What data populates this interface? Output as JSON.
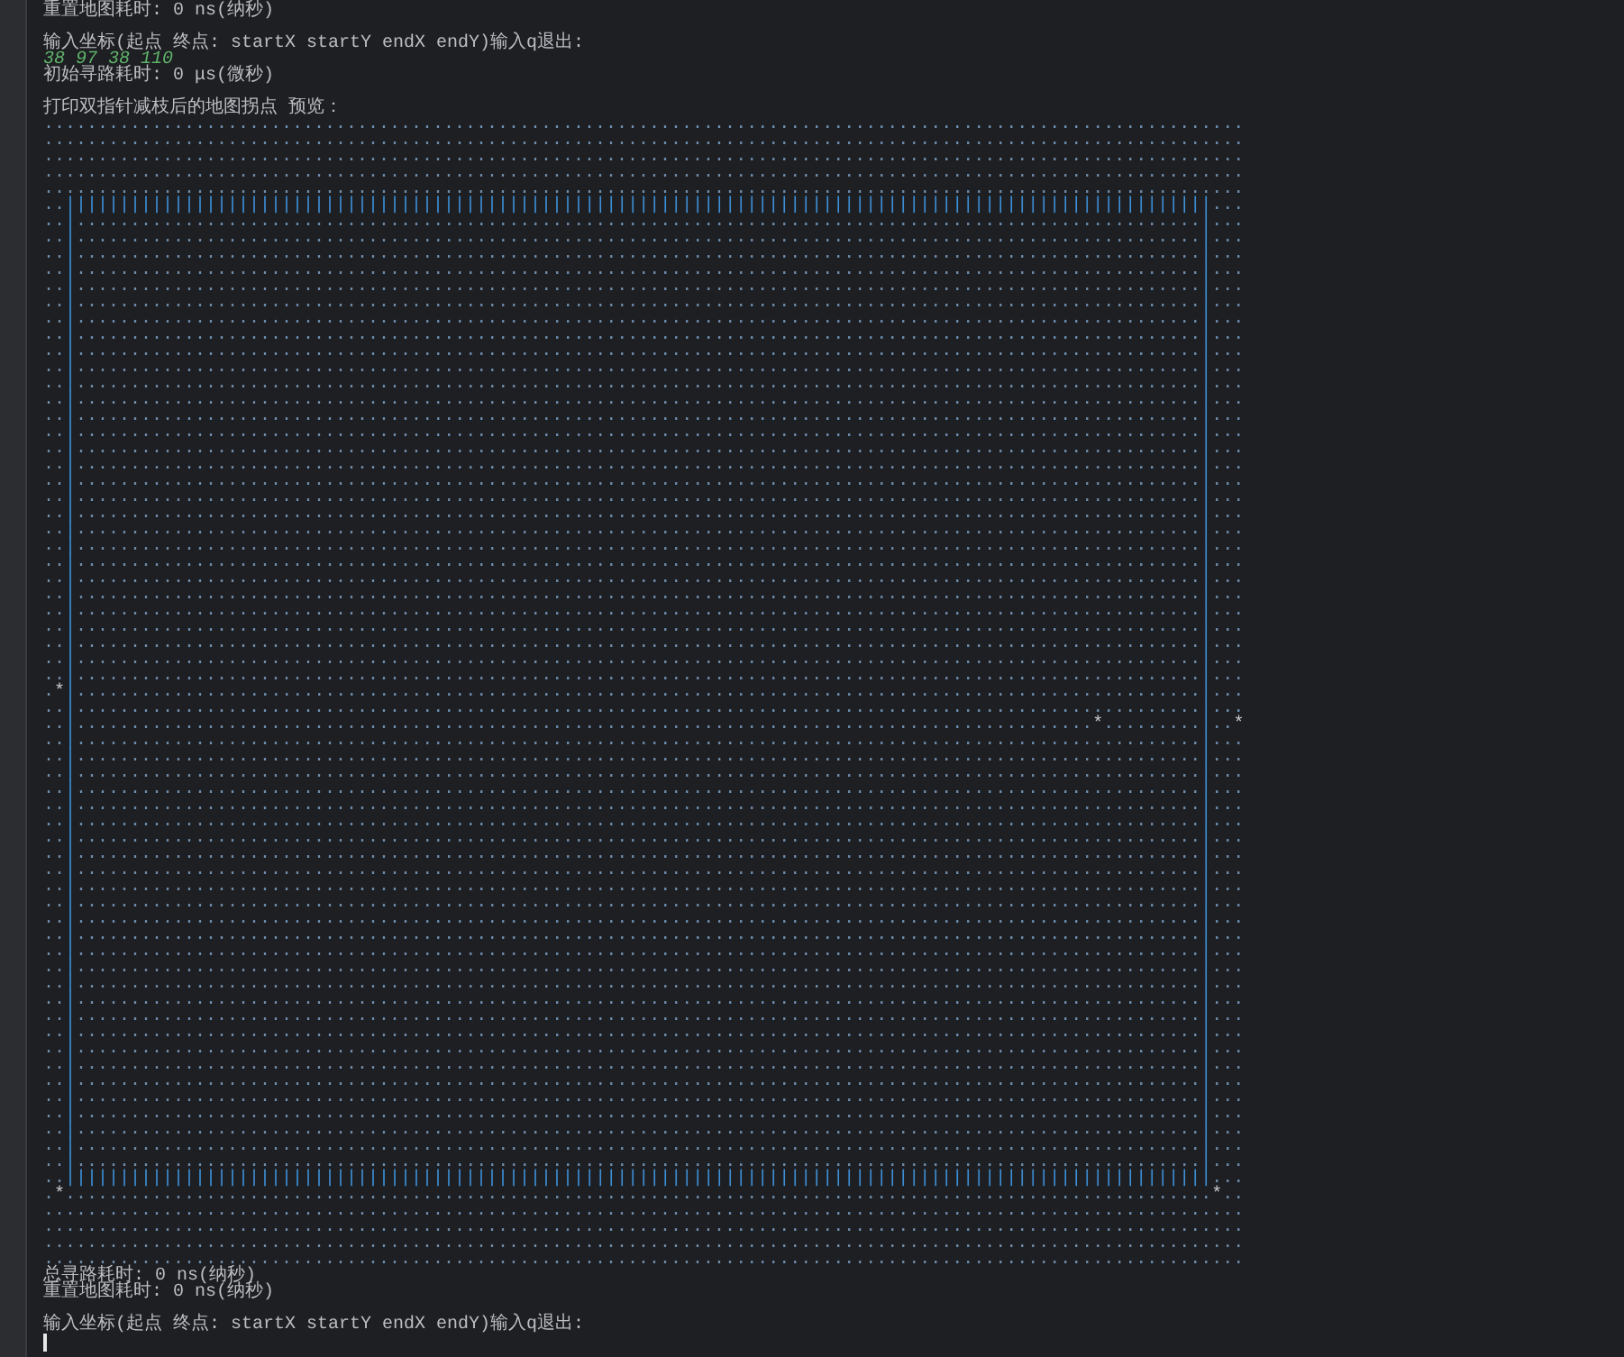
{
  "console": {
    "lines": [
      {
        "kind": "output",
        "text": "重置地图耗时: 0 ns(纳秒)"
      },
      {
        "kind": "blank"
      },
      {
        "kind": "output",
        "text": "输入坐标(起点 终点: startX startY endX endY)输入q退出:"
      },
      {
        "kind": "input",
        "text": "38 97 38 110"
      },
      {
        "kind": "output",
        "text": "初始寻路耗时: 0 μs(微秒)"
      },
      {
        "kind": "blank"
      },
      {
        "kind": "output",
        "text": "打印双指针减枝后的地图拐点 预览："
      },
      {
        "kind": "map",
        "rows": [
          "...............................................................................................................",
          "...............................................................................................................",
          "...............................................................................................................",
          "...............................................................................................................",
          "...............................................................................................................",
          "..||||||||||||||||||||||||||||||||||||||||||||||||||||||||||||||||||||||||||||||||||||||||||||||||||||||||||...",
          "..|........................................................................................................|...",
          "..|........................................................................................................|...",
          "..|........................................................................................................|...",
          "..|........................................................................................................|...",
          "..|........................................................................................................|...",
          "..|........................................................................................................|...",
          "..|........................................................................................................|...",
          "..|........................................................................................................|...",
          "..|........................................................................................................|...",
          "..|........................................................................................................|...",
          "..|........................................................................................................|...",
          "..|........................................................................................................|...",
          "..|........................................................................................................|...",
          "..|........................................................................................................|...",
          "..|........................................................................................................|...",
          "..|........................................................................................................|...",
          "..|........................................................................................................|...",
          "..|........................................................................................................|...",
          "..|........................................................................................................|...",
          "..|........................................................................................................|...",
          "..|........................................................................................................|...",
          "..|........................................................................................................|...",
          "..|........................................................................................................|...",
          "..|........................................................................................................|...",
          "..|........................................................................................................|...",
          "..|........................................................................................................|...",
          "..|........................................................................................................|...",
          "..|........................................................................................................|...",
          "..|........................................................................................................|...",
          ".*|........................................................................................................|...",
          "..|........................................................................................................|...",
          "..|..............................................................................................*.........|..*",
          "..|........................................................................................................|...",
          "..|........................................................................................................|...",
          "..|........................................................................................................|...",
          "..|........................................................................................................|...",
          "..|........................................................................................................|...",
          "..|........................................................................................................|...",
          "..|........................................................................................................|...",
          "..|........................................................................................................|...",
          "..|........................................................................................................|...",
          "..|........................................................................................................|...",
          "..|........................................................................................................|...",
          "..|........................................................................................................|...",
          "..|........................................................................................................|...",
          "..|........................................................................................................|...",
          "..|........................................................................................................|...",
          "..|........................................................................................................|...",
          "..|........................................................................................................|...",
          "..|........................................................................................................|...",
          "..|........................................................................................................|...",
          "..|........................................................................................................|...",
          "..|........................................................................................................|...",
          "..|........................................................................................................|...",
          "..|........................................................................................................|...",
          "..|........................................................................................................|...",
          "..|........................................................................................................|...",
          "..|........................................................................................................|...",
          "..|........................................................................................................|...",
          "..||||||||||||||||||||||||||||||||||||||||||||||||||||||||||||||||||||||||||||||||||||||||||||||||||||||||||...",
          ".*..........................................................................................................*..",
          "...............................................................................................................",
          "...............................................................................................................",
          "...............................................................................................................",
          "..............................................................................................................."
        ]
      },
      {
        "kind": "output",
        "text": "总寻路耗时: 0 ns(纳秒)"
      },
      {
        "kind": "output",
        "text": "重置地图耗时: 0 ns(纳秒)"
      },
      {
        "kind": "blank"
      },
      {
        "kind": "output",
        "text": "输入坐标(起点 终点: startX startY endX endY)输入q退出:"
      },
      {
        "kind": "cursor"
      }
    ]
  }
}
